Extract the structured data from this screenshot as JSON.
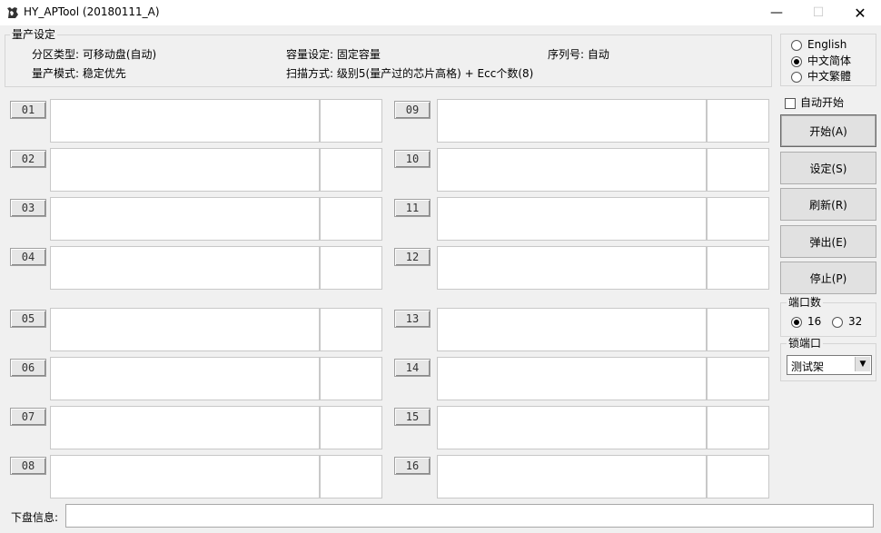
{
  "window": {
    "title": "HY_APTool (20180111_A)"
  },
  "settings": {
    "legend": "量产设定",
    "partition_type": "分区类型: 可移动盘(自动)",
    "capacity_setting": "容量设定: 固定容量",
    "serial": "序列号:  自动",
    "mode": "量产模式: 稳定优先",
    "scan": "扫描方式: 级别5(量产过的芯片高格) + Ecc个数(8)"
  },
  "ports": [
    "01",
    "02",
    "03",
    "04",
    "05",
    "06",
    "07",
    "08",
    "09",
    "10",
    "11",
    "12",
    "13",
    "14",
    "15",
    "16"
  ],
  "language": {
    "options": [
      "English",
      "中文简体",
      "中文繁體"
    ],
    "selected": 1
  },
  "auto_start": {
    "label": "自动开始",
    "checked": false
  },
  "buttons": {
    "start": "开始(A)",
    "settings": "设定(S)",
    "refresh": "刷新(R)",
    "eject": "弹出(E)",
    "stop": "停止(P)"
  },
  "port_count": {
    "legend": "端口数",
    "options": [
      "16",
      "32"
    ],
    "selected": 0
  },
  "lock_port": {
    "legend": "锁端口",
    "value": "测试架"
  },
  "disk_info": {
    "label": "下盘信息:"
  }
}
